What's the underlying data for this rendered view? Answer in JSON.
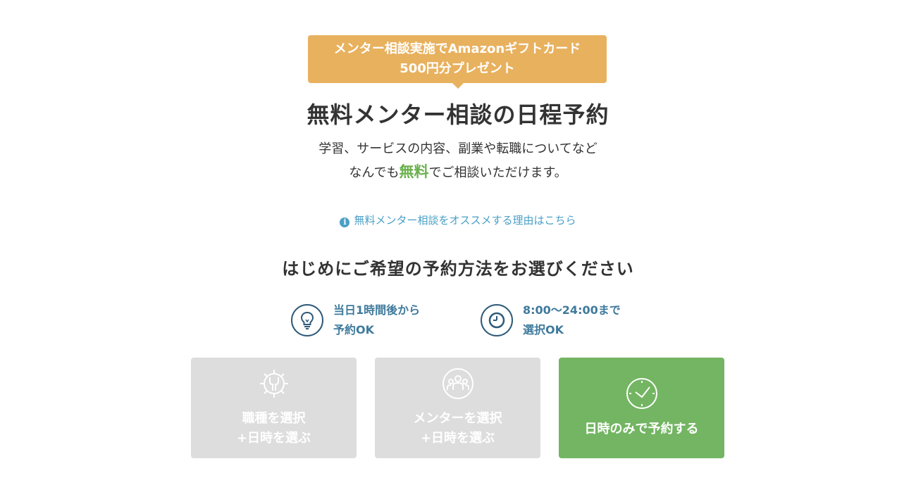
{
  "badge": {
    "line1": "メンター相談実施でAmazonギフトカード",
    "line2": "500円分プレゼント"
  },
  "title": "無料メンター相談の日程予約",
  "lead": {
    "line1": "学習、サービスの内容、副業や転職についてなど",
    "line2_before": "なんでも",
    "line2_highlight": "無料",
    "line2_after": "でご相談いただけます。"
  },
  "reason_link": {
    "icon": "info-icon",
    "label": "無料メンター相談をオススメする理由はこちら"
  },
  "section_title": "はじめにご希望の予約方法をお選びください",
  "features": [
    {
      "icon": "lightbulb-icon",
      "line1": "当日1時間後から",
      "line2": "予約OK"
    },
    {
      "icon": "clock-icon",
      "line1": "8:00〜24:00まで",
      "line2": "選択OK"
    }
  ],
  "options": [
    {
      "icon": "gear-wrench-icon",
      "line1": "職種を選択",
      "line2": "+日時を選ぶ",
      "state": "disabled"
    },
    {
      "icon": "people-icon",
      "line1": "メンターを選択",
      "line2": "+日時を選ぶ",
      "state": "disabled"
    },
    {
      "icon": "clock-icon",
      "line1": "日時のみで予約する",
      "state": "active"
    }
  ],
  "colors": {
    "badge": "#e8b15e",
    "highlight": "#6ab04c",
    "link": "#4aa0c7",
    "feature_text": "#3f7a9c",
    "option_disabled": "#dddddd",
    "option_active": "#73b562"
  }
}
